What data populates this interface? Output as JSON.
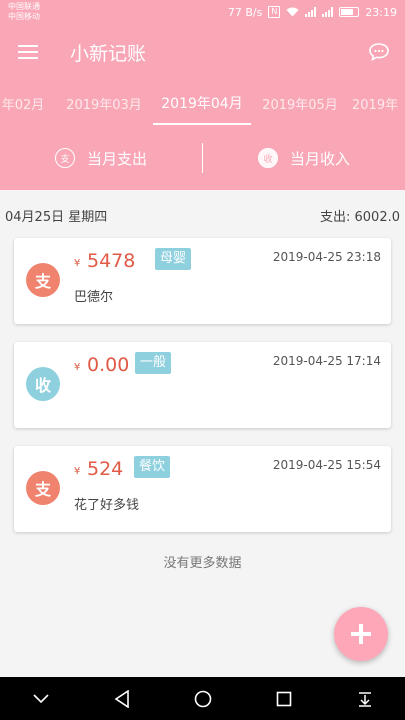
{
  "status_bar": {
    "carrier1": "中国联通",
    "carrier2": "中国移动",
    "speed": "77 B/s",
    "time": "23:19"
  },
  "app_bar": {
    "title": "小新记账",
    "menu_icon": "hamburger-menu-icon",
    "chat_icon": "chat-bubble-icon"
  },
  "months": {
    "tabs": [
      "年02月",
      "2019年03月",
      "2019年04月",
      "2019年05月",
      "2019年"
    ],
    "active_index": 2
  },
  "summary": {
    "expense_label": "当月支出",
    "income_label": "当月收入",
    "expense_icon_text": "支",
    "income_icon_text": "收"
  },
  "day_header": {
    "date": "04月25日 星期四",
    "total": "支出: 6002.0"
  },
  "records": [
    {
      "avatar": "支",
      "avatar_color": "#f0836e",
      "yen": "¥",
      "amount": "5478",
      "tag": "母婴",
      "time": "2019-04-25 23:18",
      "note": "巴德尔"
    },
    {
      "avatar": "收",
      "avatar_color": "#8fd0df",
      "yen": "¥",
      "amount": "0.00",
      "tag": "一般",
      "time": "2019-04-25 17:14",
      "note": ""
    },
    {
      "avatar": "支",
      "avatar_color": "#f0836e",
      "yen": "¥",
      "amount": "524",
      "tag": "餐饮",
      "time": "2019-04-25 15:54",
      "note": "花了好多钱"
    }
  ],
  "footer_text": "没有更多数据",
  "colors": {
    "brand_pink": "#f9a7b6",
    "expense_red": "#e05a46",
    "tag_blue": "#8fd0df"
  }
}
